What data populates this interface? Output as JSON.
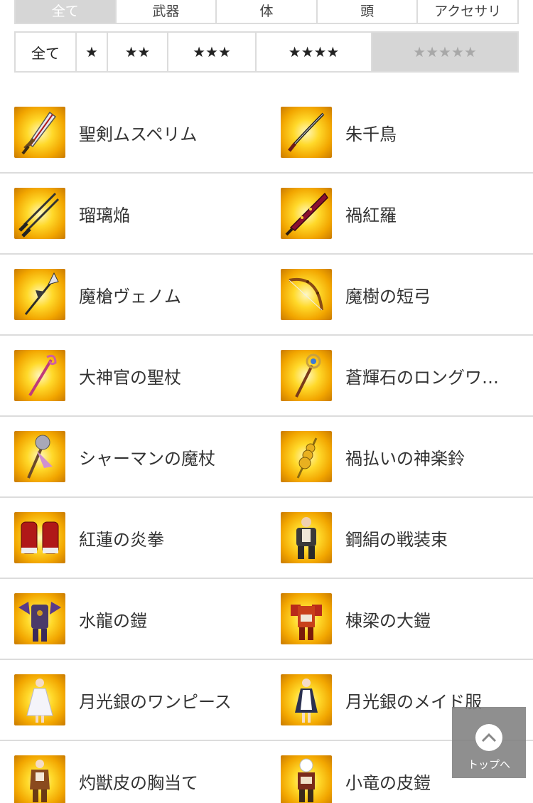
{
  "category_tabs": [
    {
      "label": "全て",
      "active": true
    },
    {
      "label": "武器",
      "active": false
    },
    {
      "label": "体",
      "active": false
    },
    {
      "label": "頭",
      "active": false
    },
    {
      "label": "アクセサリ",
      "active": false
    }
  ],
  "rarity_tabs": [
    {
      "label": "全て",
      "active": false
    },
    {
      "label": "★",
      "active": false
    },
    {
      "label": "★★",
      "active": false
    },
    {
      "label": "★★★",
      "active": false
    },
    {
      "label": "★★★★",
      "active": false
    },
    {
      "label": "★★★★★",
      "active": true
    }
  ],
  "items": [
    {
      "name": "聖剣ムスペリム",
      "icon": "sword-icon"
    },
    {
      "name": "朱千鳥",
      "icon": "katana-icon"
    },
    {
      "name": "瑠璃焔",
      "icon": "twin-blades-icon"
    },
    {
      "name": "禍紅羅",
      "icon": "crimson-blade-icon"
    },
    {
      "name": "魔槍ヴェノム",
      "icon": "spear-icon"
    },
    {
      "name": "魔樹の短弓",
      "icon": "bow-icon"
    },
    {
      "name": "大神官の聖杖",
      "icon": "staff-icon"
    },
    {
      "name": "蒼輝石のロングワ…",
      "icon": "wand-icon"
    },
    {
      "name": "シャーマンの魔杖",
      "icon": "shaman-staff-icon"
    },
    {
      "name": "禍払いの神楽鈴",
      "icon": "kagura-bell-icon"
    },
    {
      "name": "紅蓮の炎拳",
      "icon": "gauntlet-icon"
    },
    {
      "name": "鋼絹の戦装束",
      "icon": "armor-icon"
    },
    {
      "name": "水龍の鎧",
      "icon": "dragon-armor-icon"
    },
    {
      "name": "棟梁の大鎧",
      "icon": "samurai-armor-icon"
    },
    {
      "name": "月光銀のワンピース",
      "icon": "dress-icon"
    },
    {
      "name": "月光銀のメイド服",
      "icon": "maid-outfit-icon"
    },
    {
      "name": "灼獣皮の胸当て",
      "icon": "leather-armor-icon"
    },
    {
      "name": "小竜の皮鎧",
      "icon": "hide-armor-icon"
    }
  ],
  "back_to_top": {
    "label": "トップへ",
    "icon": "chevron-up-icon"
  },
  "colors": {
    "accent_gold": "#f2a600",
    "tab_active_bg": "#d6d6d6",
    "divider": "#dcdcdc"
  }
}
